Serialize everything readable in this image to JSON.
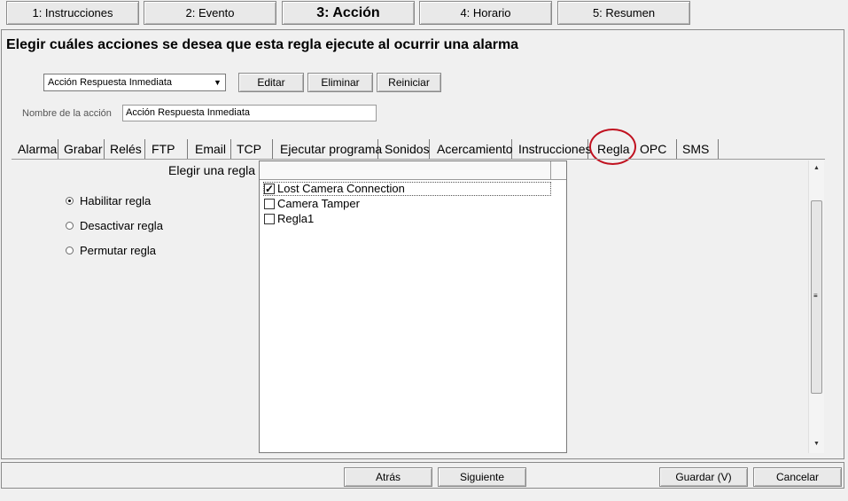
{
  "wizard": {
    "steps": [
      "1: Instrucciones",
      "2: Evento",
      "3: Acción",
      "4: Horario",
      "5: Resumen"
    ]
  },
  "header": {
    "title": "Elegir cuáles acciones se desea que esta regla ejecute al ocurrir una alarma"
  },
  "action_select": {
    "value": "Acción Respuesta Inmediata"
  },
  "toolbar": {
    "edit": "Editar",
    "delete": "Eliminar",
    "reset": "Reiniciar"
  },
  "action_name": {
    "label": "Nombre de la acción",
    "value": "Acción Respuesta Inmediata"
  },
  "tabs": [
    "Alarma",
    "Grabar",
    "Relés",
    "FTP",
    "Email",
    "TCP",
    "Ejecutar programa",
    "Sonidos",
    "Acercamiento",
    "Instrucciones",
    "Regla",
    "OPC",
    "SMS"
  ],
  "active_tab": "Regla",
  "rule_panel": {
    "choose_label": "Elegir una regla",
    "options": [
      {
        "label": "Habilitar regla",
        "selected": true
      },
      {
        "label": "Desactivar regla",
        "selected": false
      },
      {
        "label": "Permutar regla",
        "selected": false
      }
    ],
    "rules": [
      {
        "name": "Lost Camera Connection",
        "checked": true
      },
      {
        "name": "Camera Tamper",
        "checked": false
      },
      {
        "name": "Regla1",
        "checked": false
      }
    ]
  },
  "footer": {
    "back": "Atrás",
    "next": "Siguiente",
    "save": "Guardar (V)",
    "cancel": "Cancelar"
  },
  "colors": {
    "highlight_circle": "#c0111f"
  }
}
